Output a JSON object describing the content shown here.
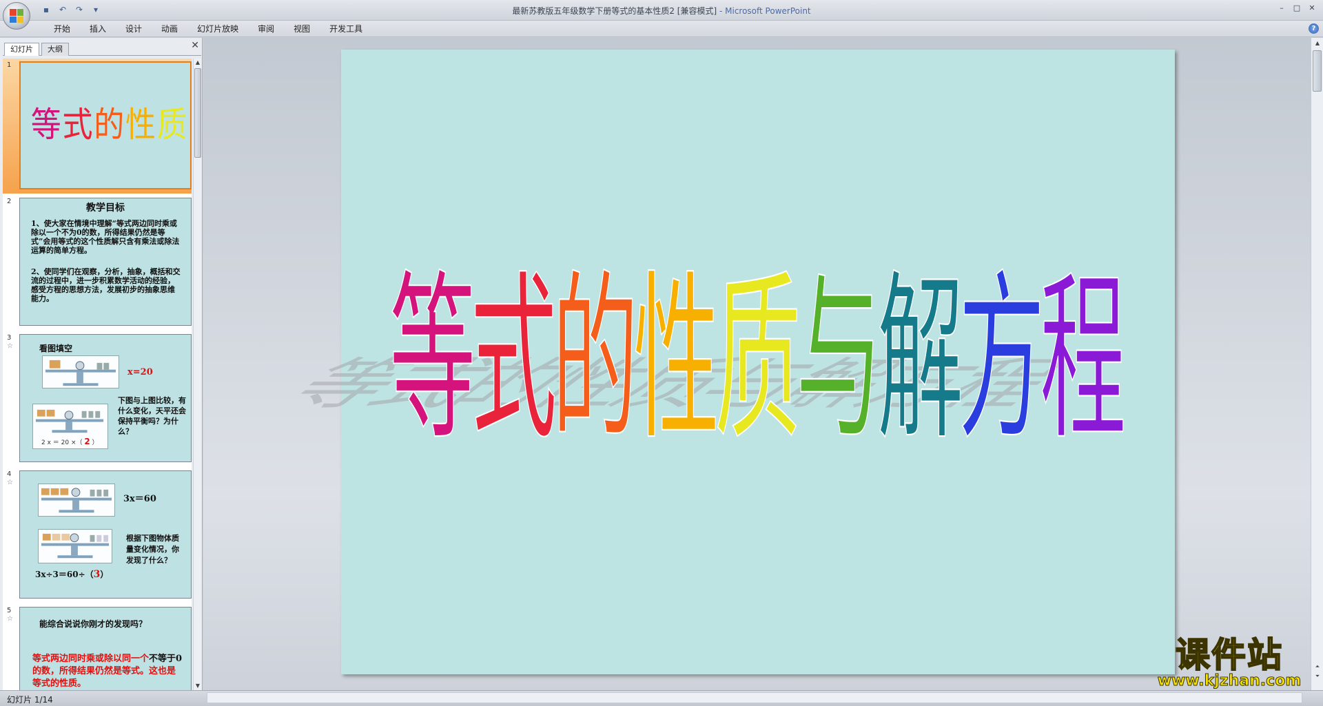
{
  "window": {
    "title": "最新苏教版五年级数学下册等式的基本性质2 [兼容模式]",
    "app": " - Microsoft PowerPoint"
  },
  "ribbon": {
    "tabs": [
      "开始",
      "插入",
      "设计",
      "动画",
      "幻灯片放映",
      "审阅",
      "视图",
      "开发工具"
    ]
  },
  "pane": {
    "tab_slides": "幻灯片",
    "tab_outline": "大纲"
  },
  "slides": [
    {
      "num": "1",
      "title": "等式的性质与解方程"
    },
    {
      "num": "2",
      "heading": "教学目标",
      "p1": "1、使大家在情境中理解“等式两边同时乘或除以一个不为0的数，所得结果仍然是等式”会用等式的这个性质解只含有乘法或除法运算的简单方程。",
      "p2": "2、使同学们在观察，分析，抽象，概括和交流的过程中，进一步积累数学活动的经验，感受方程的思想方法，发展初步的抽象思维能力。"
    },
    {
      "num": "3",
      "heading": "看图填空",
      "eq": "x=20",
      "question": "下图与上图比较，有什么变化，天平还会保持平衡吗？为什么？",
      "caption": "2 x ＝ 20 ×（ ",
      "answer": "2",
      "caption_end": " ）"
    },
    {
      "num": "4",
      "eq": "3x＝60",
      "question": "根据下图物体质量变化情况，你发现了什么？",
      "eq2": "3x÷3＝60÷（",
      "answer": "3",
      "eq2_end": "）"
    },
    {
      "num": "5",
      "heading": "能综合说说你刚才的发现吗？",
      "red": "等式两边同时乘或除以同一个",
      "black": "不等于0",
      "red2": "的数，所得结果仍然是等式。这也是等式的性质。"
    }
  ],
  "main_slide": {
    "title_chars": [
      "等",
      "式",
      "的",
      "性",
      "质",
      "与",
      "解",
      "方",
      "程"
    ],
    "colors": [
      "#d4147c",
      "#e8233a",
      "#f45e1a",
      "#f7b000",
      "#e8e820",
      "#55b02a",
      "#157a8a",
      "#2a3ee0",
      "#8a1ad6"
    ]
  },
  "status": {
    "slide_counter": "幻灯片 1/14"
  },
  "watermark": {
    "text": "课件站",
    "url": "www.kjzhan.com"
  }
}
